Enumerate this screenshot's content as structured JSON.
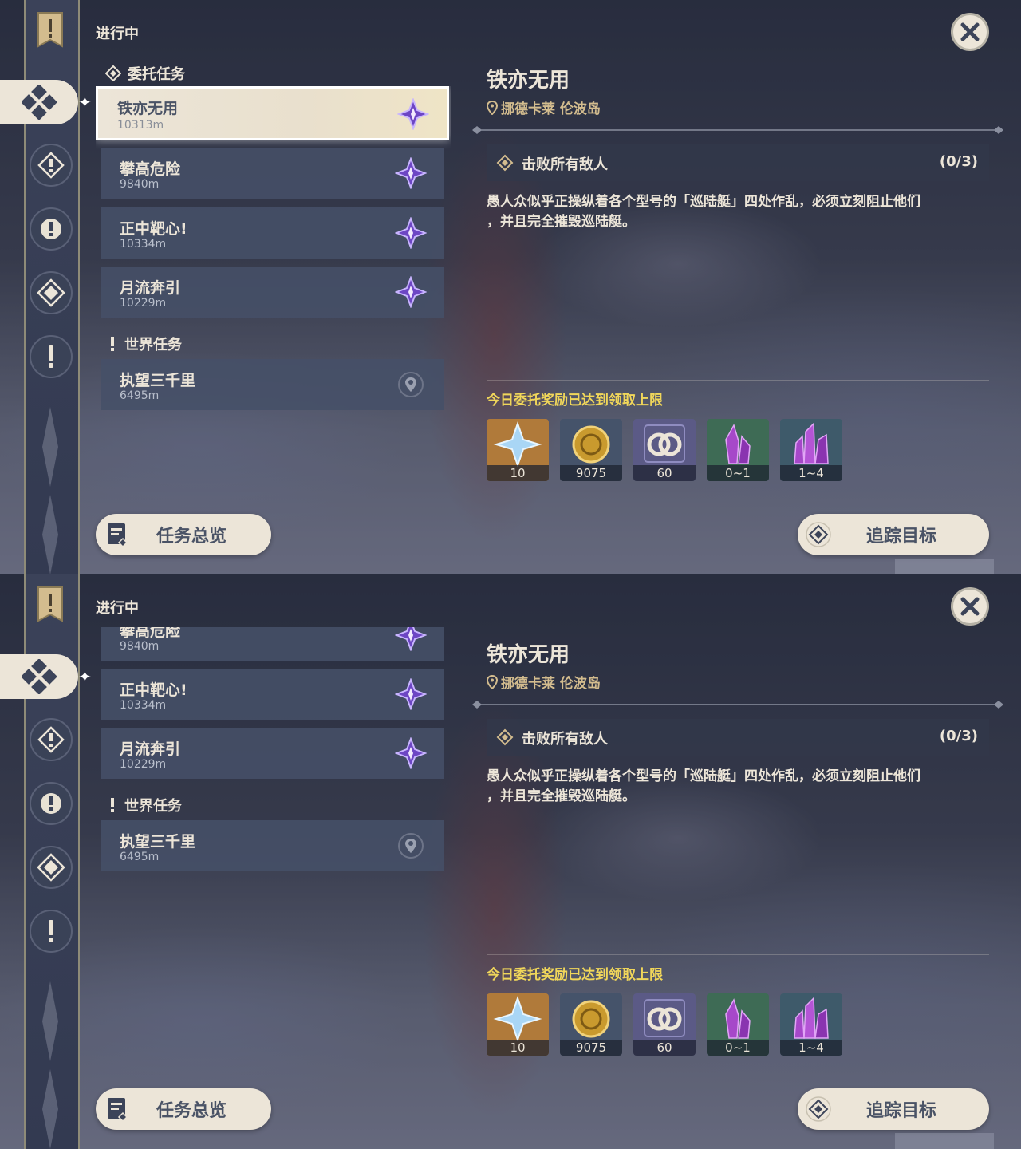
{
  "header": {
    "status_label": "进行中",
    "close_icon": "close-icon"
  },
  "sections": {
    "commissions": "委托任务",
    "world": "世界任务"
  },
  "quests": [
    {
      "name": "铁亦无用",
      "distance": "10313m",
      "type": "commission",
      "icon": "commission-star-icon"
    },
    {
      "name": "攀高危险",
      "distance": "9840m",
      "type": "commission",
      "icon": "commission-star-icon"
    },
    {
      "name": "正中靶心!",
      "distance": "10334m",
      "type": "commission",
      "icon": "commission-star-icon"
    },
    {
      "name": "月流奔引",
      "distance": "10229m",
      "type": "commission",
      "icon": "commission-star-icon"
    },
    {
      "name": "执望三千里",
      "distance": "6495m",
      "type": "world",
      "icon": "location-pin-icon"
    }
  ],
  "detail": {
    "title": "铁亦无用",
    "location": "挪德卡莱 伦波岛",
    "objective": "击败所有敌人",
    "progress": "(0/3)",
    "description_line1": "愚人众似乎正操纵着各个型号的「巡陆艇」四处作乱，必须立刻阻止他们",
    "description_line2": "，并且完全摧毁巡陆艇。",
    "reward_note": "今日委托奖励已达到领取上限",
    "rewards": [
      {
        "item": "primogem",
        "count": "10",
        "color": "#b07a3a"
      },
      {
        "item": "mora",
        "count": "9075",
        "color": "#45536a"
      },
      {
        "item": "companionship-exp",
        "count": "60",
        "color": "#5b5a86"
      },
      {
        "item": "crystal-ore",
        "count": "0~1",
        "color": "#3e6b55"
      },
      {
        "item": "crystal-cluster",
        "count": "1~4",
        "color": "#3e5a6a"
      }
    ]
  },
  "buttons": {
    "overview": "任务总览",
    "track": "追踪目标"
  },
  "colors": {
    "accent_cream": "#ece5d8",
    "gold_text": "#d3bc8e",
    "reward_note": "#f0d65a",
    "purple_star": "#8b5fd6"
  }
}
